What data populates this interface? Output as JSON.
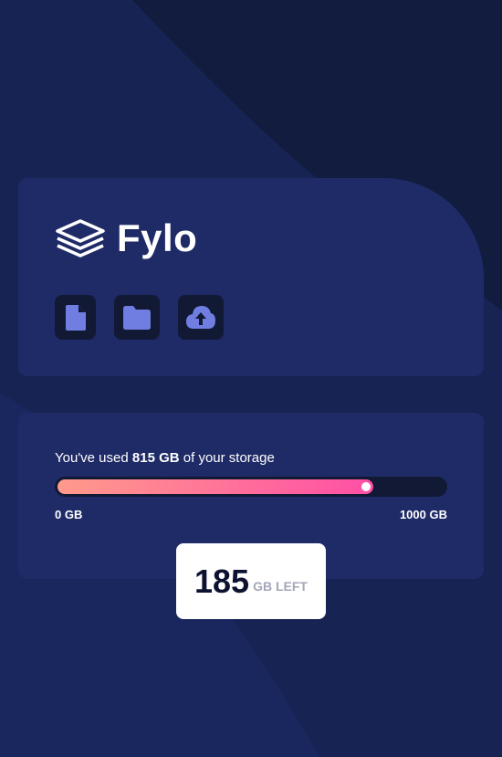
{
  "brand": {
    "name": "Fylo"
  },
  "actions": [
    {
      "icon": "document-icon"
    },
    {
      "icon": "folder-icon"
    },
    {
      "icon": "upload-icon"
    }
  ],
  "storage": {
    "used_prefix": "You've used ",
    "used_value": "815 GB",
    "used_suffix": " of your storage",
    "used_fraction": 0.815,
    "min_label": "0 GB",
    "max_label": "1000 GB",
    "left_value": "185",
    "left_label": "GB LEFT"
  },
  "colors": {
    "background": "#121c3f",
    "card": "#1f2b67",
    "icon_bg": "#111935",
    "icon_fill": "#6f7ee0",
    "bar_start": "#ff9a8b",
    "bar_end": "#ff4fa5"
  }
}
